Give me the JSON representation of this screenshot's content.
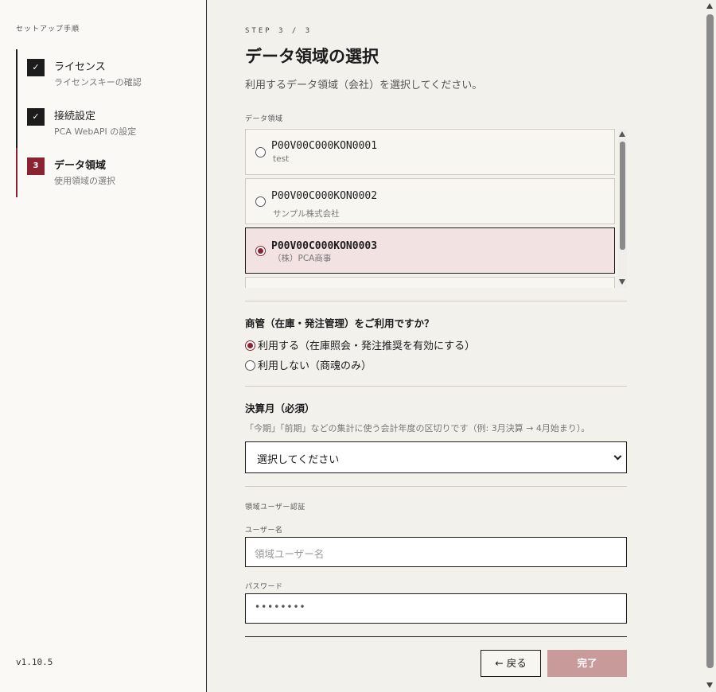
{
  "sidebar": {
    "heading": "セットアップ手順",
    "steps": [
      {
        "marker": "✓",
        "title": "ライセンス",
        "subtitle": "ライセンスキーの確認",
        "status": "done"
      },
      {
        "marker": "✓",
        "title": "接続設定",
        "subtitle": "PCA WebAPI の設定",
        "status": "done"
      },
      {
        "marker": "3",
        "title": "データ領域",
        "subtitle": "使用領域の選択",
        "status": "active"
      }
    ],
    "version": "v1.10.5"
  },
  "main": {
    "step_label": "STEP 3 / 3",
    "title": "データ領域の選択",
    "description": "利用するデータ領域（会社）を選択してください。",
    "area_label": "データ領域",
    "areas": [
      {
        "code": "P00V00C000KON0001",
        "name": "test",
        "selected": false
      },
      {
        "code": "P00V00C000KON0002",
        "name": "サンプル株式会社",
        "selected": false
      },
      {
        "code": "P00V00C000KON0003",
        "name": "（株）PCA商事",
        "selected": true
      }
    ],
    "inventory_question": "商管（在庫・発注管理）をご利用ですか？",
    "inventory_options": [
      {
        "label": "利用する（在庫照会・発注推奨を有効にする）",
        "selected": true
      },
      {
        "label": "利用しない（商魂のみ）",
        "selected": false
      }
    ],
    "fiscal_label": "決算月（必須）",
    "fiscal_hint": "「今期」「前期」などの集計に使う会計年度の区切りです（例: 3月決算 → 4月始まり）。",
    "fiscal_select_value": "選択してください",
    "auth_label": "領域ユーザー認証",
    "username_label": "ユーザー名",
    "username_placeholder": "領域ユーザー名",
    "password_label": "パスワード",
    "password_value": "••••••••",
    "back_button": "← 戻る",
    "done_button": "完了"
  },
  "colors": {
    "accent": "#8b2232",
    "done_button_disabled": "#c99a9a",
    "selected_row_bg": "#f3e2e2",
    "page_bg": "#f3f1ec"
  }
}
